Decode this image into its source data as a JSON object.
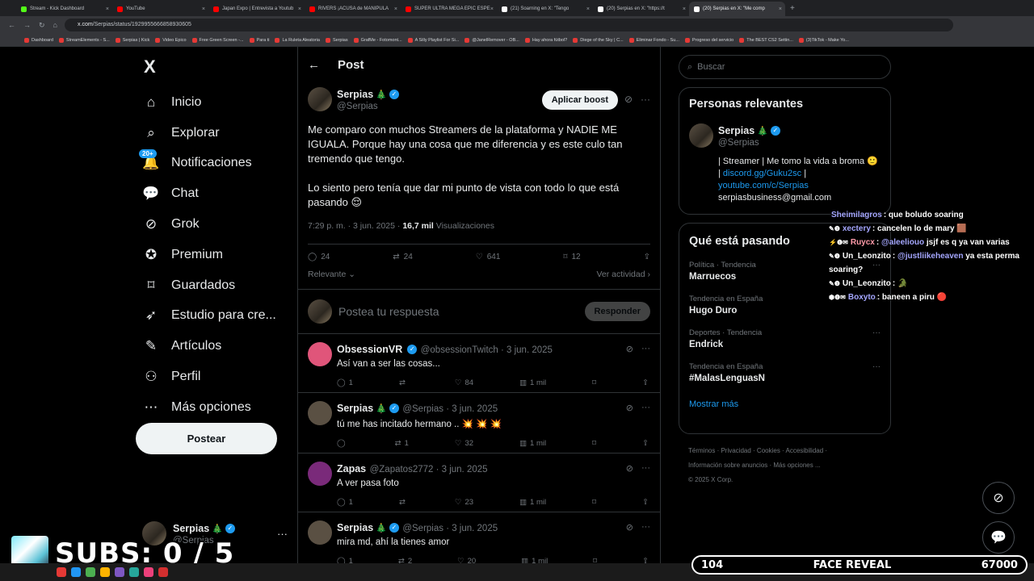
{
  "browser": {
    "tabs": [
      {
        "label": "Stream - Kick Dashboard",
        "color": "#53fc18"
      },
      {
        "label": "YouTube",
        "color": "#ff0000"
      },
      {
        "label": "Japan Expo | Entrevista a Youtub",
        "color": "#ff0000"
      },
      {
        "label": "RIVERS ¡ACUSA de MANIPULA",
        "color": "#ff0000"
      },
      {
        "label": "SUPER ULTRA MEGA EPIC ESPE",
        "color": "#ff0000"
      },
      {
        "label": "(21) Soarning en X: \"Tengo",
        "color": "#ffffff"
      },
      {
        "label": "(20) Serpias en X: \"https://t",
        "color": "#ffffff"
      },
      {
        "label": "(20) Serpias en X: \"Me comp",
        "color": "#ffffff"
      }
    ],
    "new_tab": "+",
    "url_host": "x.com",
    "url_path": "/Serpias/status/1929955666858930605",
    "bookmarks": [
      "Dashboard",
      "StreamElements - S...",
      "Serpias | Kick",
      "Video Epico",
      "Free Green Screen -...",
      "Para ti",
      "La Ruleta Aleatoria",
      "Serpias",
      "GrafMe - Fotomont...",
      "A Silly Playlist For Si...",
      "@JanelRemover - OB...",
      "Hay ahora fútbol?",
      "Diege of the Sky | C...",
      "Eliminar Fondo - Su...",
      "Progreso del servicio",
      "The BEST CS2 Settin...",
      "(3)TikTok - Make Yo..."
    ]
  },
  "sidebar": {
    "logo": "X",
    "items": [
      {
        "label": "Inicio",
        "icon": "home-icon"
      },
      {
        "label": "Explorar",
        "icon": "search-icon"
      },
      {
        "label": "Notificaciones",
        "icon": "bell-icon",
        "badge": "20+"
      },
      {
        "label": "Chat",
        "icon": "chat-icon"
      },
      {
        "label": "Grok",
        "icon": "grok-icon"
      },
      {
        "label": "Premium",
        "icon": "premium-icon"
      },
      {
        "label": "Guardados",
        "icon": "bookmark-icon"
      },
      {
        "label": "Estudio para cre...",
        "icon": "rocket-icon"
      },
      {
        "label": "Artículos",
        "icon": "article-icon"
      },
      {
        "label": "Perfil",
        "icon": "person-icon"
      },
      {
        "label": "Más opciones",
        "icon": "more-icon"
      }
    ],
    "post_button": "Postear",
    "account": {
      "name": "Serpias",
      "handle": "@Serpias",
      "menu": "···"
    }
  },
  "main": {
    "header": {
      "back": "←",
      "title": "Post"
    },
    "post": {
      "name": "Serpias",
      "handle": "@Serpias",
      "boost": "Aplicar boost",
      "text": "Me comparo con muchos Streamers de la plataforma y NADIE ME IGUALA. Porque hay una cosa que me diferencia y es este culo tan tremendo que tengo.\n\nLo siento pero tenía que dar mi punto de vista con todo lo que está pasando 😌",
      "time": "7:29 p. m. · 3 jun. 2025 ·",
      "views": "16,7 mil",
      "views_label": "Visualizaciones",
      "replies": "24",
      "reposts": "24",
      "likes": "641",
      "bookmarks": "12",
      "sort": "Relevante",
      "activity": "Ver actividad"
    },
    "reply_box": {
      "placeholder": "Postea tu respuesta",
      "button": "Responder"
    },
    "comments": [
      {
        "name": "ObsessionVR",
        "handle": "@obsessionTwitch · 3 jun. 2025",
        "text": "Así van a ser las cosas...",
        "replies": "1",
        "reposts": "",
        "likes": "84",
        "views": "1 mil",
        "avatar": "#e0557a",
        "verified": true
      },
      {
        "name": "Serpias",
        "handle": "@Serpias · 3 jun. 2025",
        "text": "tú me has incitado hermano .. 💥 💥 💥",
        "replies": "",
        "reposts": "1",
        "likes": "32",
        "views": "1 mil",
        "avatar": "#5a5043",
        "verified": true
      },
      {
        "name": "Zapas",
        "handle": "@Zapatos2772 · 3 jun. 2025",
        "text": "A ver pasa foto",
        "replies": "1",
        "reposts": "",
        "likes": "23",
        "views": "1 mil",
        "avatar": "#7a2a7a",
        "verified": false
      },
      {
        "name": "Serpias",
        "handle": "@Serpias · 3 jun. 2025",
        "text": "mira md, ahí la tienes amor",
        "replies": "1",
        "reposts": "2",
        "likes": "20",
        "views": "1 mil",
        "avatar": "#5a5043",
        "verified": true
      }
    ]
  },
  "right": {
    "search_placeholder": "Buscar",
    "relevant_title": "Personas relevantes",
    "relevant": {
      "name": "Serpias",
      "handle": "@Serpias",
      "bio_1": "| Streamer | Me tomo la vida a broma 🙂 |",
      "bio_link1": "discord.gg/Guku2sc",
      "bio_sep": "|",
      "bio_link2": "youtube.com/c/Serpias",
      "bio_email": "serpiasbusiness@gmail.com"
    },
    "trends_title": "Qué está pasando",
    "trends": [
      {
        "category": "Política · Tendencia",
        "name": "Marruecos"
      },
      {
        "category": "Tendencia en España",
        "name": "Hugo Duro"
      },
      {
        "category": "Deportes · Tendencia",
        "name": "Endrick"
      },
      {
        "category": "Tendencia en España",
        "name": "#MalasLenguasN"
      }
    ],
    "show_more": "Mostrar más",
    "footer_1": "Términos · Privacidad · Cookies · Accesibilidad ·",
    "footer_2": "Información sobre anuncios · Más opciones ...",
    "footer_3": "© 2025 X Corp."
  },
  "stream_chat": [
    {
      "user": "Sheimilagros",
      "color": "#a5a7ff",
      "msg": ": que boludo soaring",
      "prefix": ""
    },
    {
      "user": "xectery",
      "color": "#a5a7ff",
      "msg": ": cancelen lo de mary 🟫",
      "prefix": "✎❶"
    },
    {
      "user": "Ruycx",
      "color": "#ff9aa8",
      "msg": ": ",
      "mention": "@aleeliouo",
      "after": " jsjf es q ya van varias",
      "prefix": "⚡❶✉"
    },
    {
      "user": "Un_Leonzito",
      "color": "#ffffff",
      "msg": ": ",
      "mention": "@justliikeheaven",
      "after": " ya esta perma soaring?",
      "prefix": "✎❶"
    },
    {
      "user": "Un_Leonzito",
      "color": "#ffffff",
      "msg": ": 🐊",
      "prefix": "✎❶"
    },
    {
      "user": "Boxyto",
      "color": "#a5a7ff",
      "msg": ": baneen a piru 🔴",
      "prefix": "⬢❶✉"
    }
  ],
  "overlay": {
    "subs": "SUBS: 0 / 5",
    "bar_left": "104",
    "bar_center": "FACE REVEAL",
    "bar_right": "67000"
  }
}
